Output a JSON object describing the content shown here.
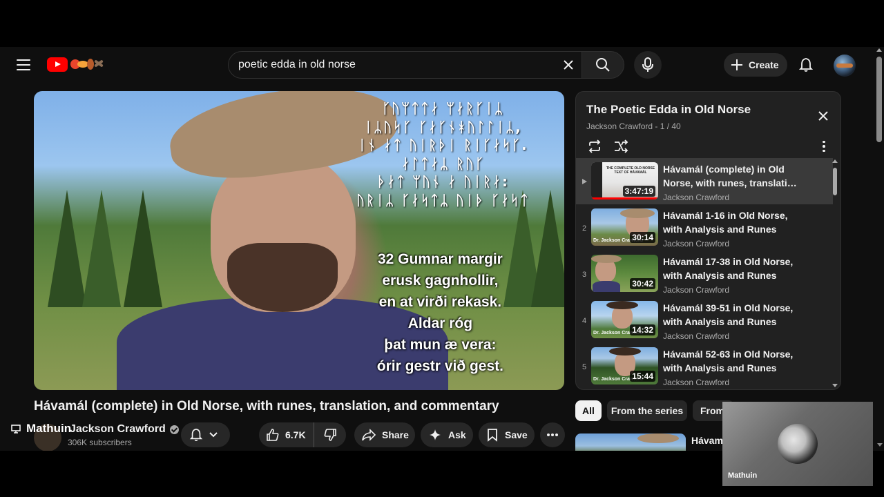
{
  "header": {
    "search_value": "poetic edda in old norse",
    "create_label": "Create",
    "icons": [
      "menu-icon",
      "youtube-logo",
      "clear-icon",
      "search-icon",
      "mic-icon",
      "plus-icon",
      "bell-icon"
    ]
  },
  "video": {
    "runes": [
      "ᚴᚢᛘᛏᛏᛅ ᛘᛅᚱᚴᛁᛦ",
      "ᛁᛦᚢᛋᚴ ᚴᛅᚴᚾᚼᚢᛚᛚᛁᛦ,",
      "ᛁᚾ ᛅᛏ ᚢᛁᚱᚦᛁ ᚱᛁᚴᛅᛋᚴ.",
      "ᛅᛚᛏᛅᛦ ᚱᚢᚴ",
      "ᚦᛅᛏ ᛘᚢᚾ ᛅ ᚢᛁᚱᛅ:",
      "ᚢᚱᛁᛦ ᚴᛅᛋᛏᛦ ᚢᛁᚦ ᚴᛅᛋᛏ"
    ],
    "verse": [
      "32 Gumnar margir",
      "erusk gagnhollir,",
      "en at virði rekask.",
      "Aldar róg",
      "þat mun æ vera:",
      "órir gestr við gest."
    ],
    "title": "Hávamál (complete) in Old Norse, with runes, translation, and commentary"
  },
  "channel": {
    "name": "Jackson Crawford",
    "subscribers": "306K subscribers",
    "watermark": "Mathuin"
  },
  "actions": {
    "likes": "6.7K",
    "share": "Share",
    "ask": "Ask",
    "save": "Save"
  },
  "playlist": {
    "title": "The Poetic Edda in Old Norse",
    "meta": "Jackson Crawford - 1 / 40",
    "items": [
      {
        "index": "",
        "title_1": "Hávamál (complete) in Old",
        "title_2": "Norse, with runes, translation,...",
        "channel": "Jackson Crawford",
        "duration": "3:47:19",
        "thumb_label": "THE COMPLETE OLD NORSE TEXT OF HÁVAMÁL"
      },
      {
        "index": "2",
        "title_1": "Hávamál 1-16 in Old Norse,",
        "title_2": "with Analysis and Runes",
        "channel": "Jackson Crawford",
        "duration": "30:14",
        "thumb_label": "Dr. Jackson Crawford"
      },
      {
        "index": "3",
        "title_1": "Hávamál 17-38 in Old Norse,",
        "title_2": "with Analysis and Runes",
        "channel": "Jackson Crawford",
        "duration": "30:42",
        "thumb_label": ""
      },
      {
        "index": "4",
        "title_1": "Hávamál 39-51 in Old Norse,",
        "title_2": "with Analysis and Runes",
        "channel": "Jackson Crawford",
        "duration": "14:32",
        "thumb_label": "Dr. Jackson Crawford"
      },
      {
        "index": "5",
        "title_1": "Hávamál 52-63 in Old Norse,",
        "title_2": "with Analysis and Runes",
        "channel": "Jackson Crawford",
        "duration": "15:44",
        "thumb_label": "Dr. Jackson Crawford"
      }
    ]
  },
  "chips": [
    "All",
    "From the series",
    "From"
  ],
  "recommendation": {
    "title": "Hávamá"
  },
  "webcam": {
    "label": "Mathuin"
  }
}
